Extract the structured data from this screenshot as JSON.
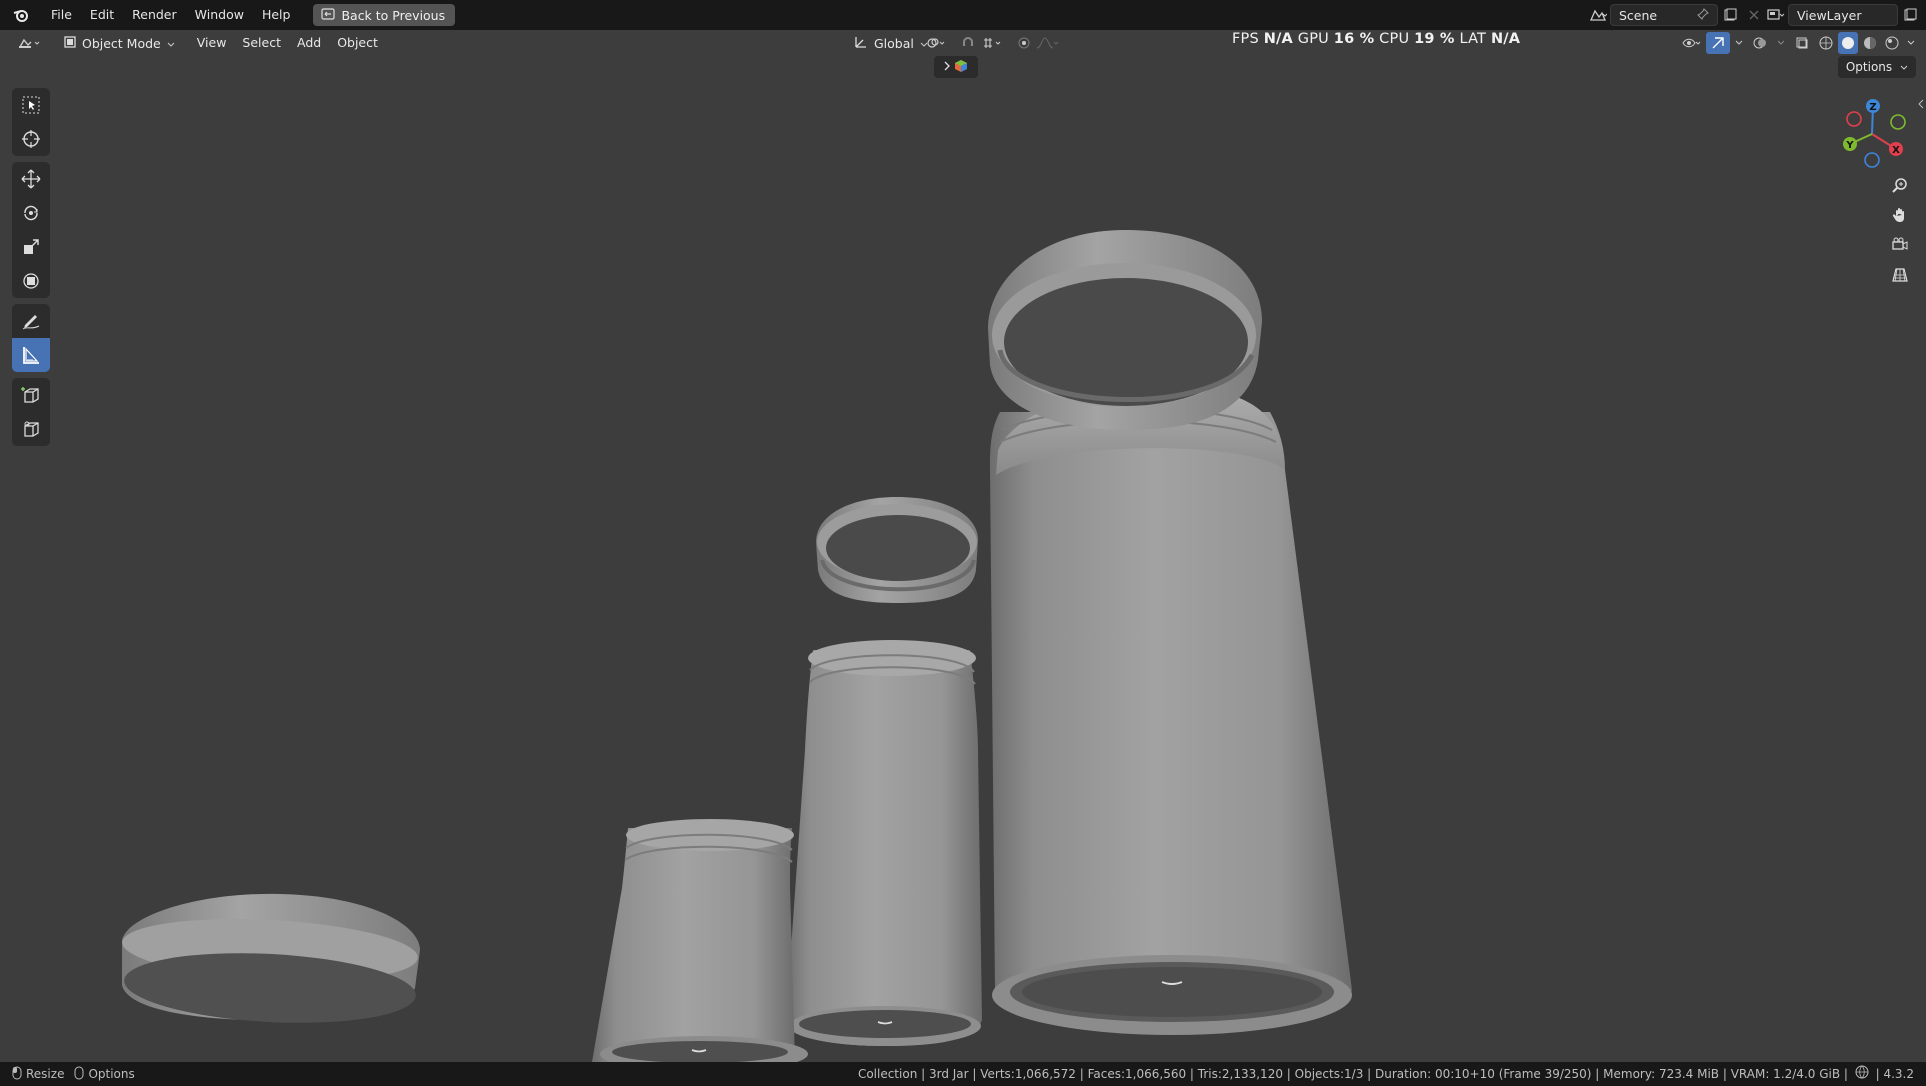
{
  "menubar": {
    "items": [
      "File",
      "Edit",
      "Render",
      "Window",
      "Help"
    ],
    "back_button": "Back to Previous",
    "scene_name": "Scene",
    "view_layer": "ViewLayer"
  },
  "viewport_header": {
    "mode": "Object Mode",
    "menus": [
      "View",
      "Select",
      "Add",
      "Object"
    ],
    "transform_orientation": "Global"
  },
  "performance": {
    "fps_label": "FPS",
    "fps_value": "N/A",
    "gpu_label": "GPU",
    "gpu_value": "16 %",
    "cpu_label": "CPU",
    "cpu_value": "19 %",
    "lat_label": "LAT",
    "lat_value": "N/A"
  },
  "options_label": "Options",
  "gizmo": {
    "x": "X",
    "y": "Y",
    "z": "Z"
  },
  "statusbar": {
    "left_resize": "Resize",
    "left_options": "Options",
    "info": "Collection | 3rd Jar | Verts:1,066,572 | Faces:1,066,560 | Tris:2,133,120 | Objects:1/3 | Duration: 00:10+10 (Frame 39/250) | Memory: 723.4 MiB | VRAM: 1.2/4.0 GiB |",
    "version": "4.3.2"
  },
  "colors": {
    "accent": "#4772b3",
    "gizmo_x": "#e0404d",
    "gizmo_y": "#7fba2e",
    "gizmo_z": "#3d86d8"
  }
}
